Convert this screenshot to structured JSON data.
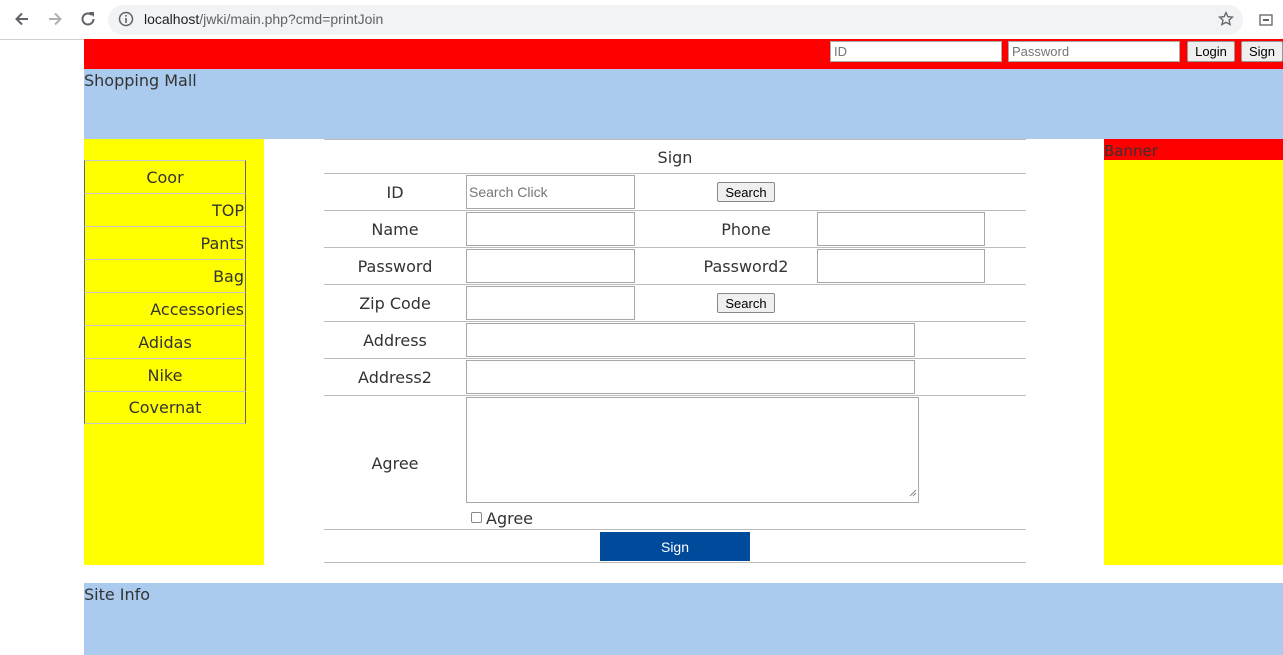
{
  "browser": {
    "url_host": "localhost",
    "url_path": "/jwki/main.php?cmd=printJoin",
    "icons": [
      "back-icon",
      "forward-icon",
      "reload-icon",
      "info-icon",
      "star-icon",
      "extension-icon"
    ]
  },
  "topbar": {
    "id_placeholder": "ID",
    "password_placeholder": "Password",
    "login_label": "Login",
    "sign_label": "Sign",
    "color": "#ff0000"
  },
  "header": {
    "title": "Shopping Mall",
    "color": "#abcbee"
  },
  "menu": {
    "items": [
      {
        "label": "Coor"
      },
      {
        "label": "TOP"
      },
      {
        "label": "Pants"
      },
      {
        "label": "Bag"
      },
      {
        "label": "Accessories"
      },
      {
        "label": "Adidas"
      },
      {
        "label": "Nike"
      },
      {
        "label": "Covernat"
      }
    ]
  },
  "form": {
    "title": "Sign",
    "id_label": "ID",
    "id_placeholder": "Search Click",
    "search_label": "Search",
    "name_label": "Name",
    "phone_label": "Phone",
    "password_label": "Password",
    "password2_label": "Password2",
    "zip_label": "Zip Code",
    "zip_search_label": "Search",
    "address_label": "Address",
    "address2_label": "Address2",
    "agree_label": "Agree",
    "agree_checkbox_label": "Agree",
    "submit_label": "Sign",
    "submit_color": "#004a9c"
  },
  "banner": {
    "label": "Banner"
  },
  "footer": {
    "label": "Site Info"
  }
}
